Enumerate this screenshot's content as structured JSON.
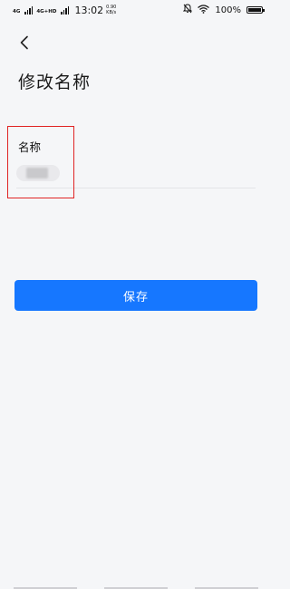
{
  "status_bar": {
    "net1": "4G",
    "net2": "4G+HD",
    "time": "13:02",
    "speed_value": "0.90",
    "speed_unit": "KB/s",
    "battery": "100%",
    "battery_level": 1.0,
    "icons": [
      "signal-icon",
      "mute-icon",
      "wifi-icon",
      "battery-icon"
    ]
  },
  "header": {
    "back_icon": "chevron-left-icon",
    "title": "修改名称"
  },
  "form": {
    "name_label": "名称",
    "name_value": ""
  },
  "actions": {
    "save_label": "保存"
  },
  "colors": {
    "accent": "#1677ff",
    "highlight": "#e02424",
    "background": "#f5f6f8"
  }
}
